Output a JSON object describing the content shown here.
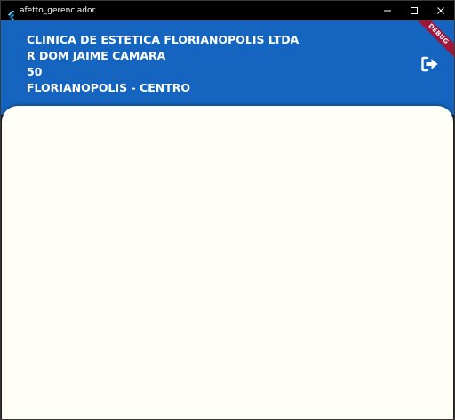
{
  "window": {
    "title": "afetto_gerenciador"
  },
  "header": {
    "lines": [
      "CLINICA DE ESTETICA FLORIANOPOLIS LTDA",
      "R DOM JAIME CAMARA",
      "50",
      "FLORIANOPOLIS - CENTRO"
    ]
  },
  "debug_banner": {
    "label": "DEBUG"
  },
  "colors": {
    "header_bg": "#1565c0",
    "content_bg": "#fffff8",
    "banner": "#a0163b"
  },
  "icons": {
    "app": "flutter-icon",
    "minimize": "minimize-icon",
    "maximize": "maximize-icon",
    "close": "close-icon",
    "logout": "logout-icon"
  }
}
